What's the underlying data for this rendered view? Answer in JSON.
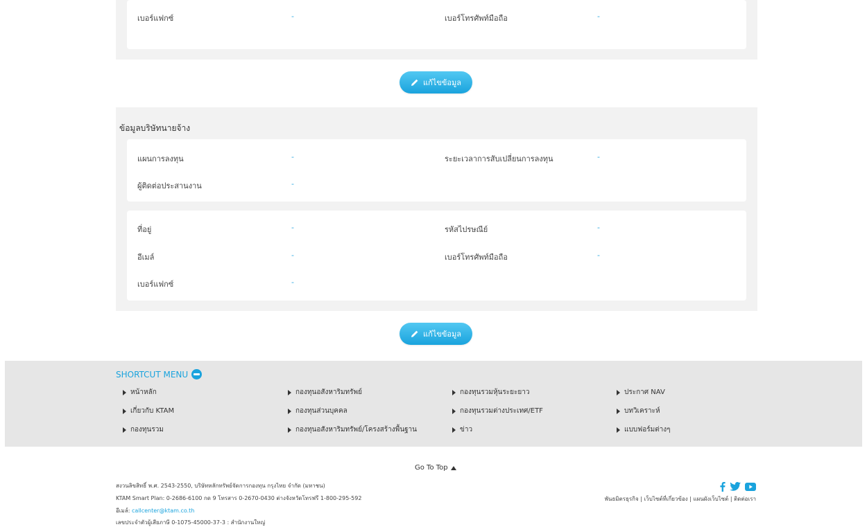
{
  "panel1": {
    "fields": [
      {
        "label": "เบอร์แฟกซ์",
        "value": "-"
      },
      {
        "label": "เบอร์โทรศัพท์มือถือ",
        "value": "-"
      }
    ]
  },
  "edit_button": {
    "label": "แก้ไขข้อมูล"
  },
  "employer": {
    "title": "ข้อมูลบริษัทนายจ้าง",
    "card1": [
      {
        "label": "แผนการลงทุน",
        "value": "-"
      },
      {
        "label": "ระยะเวลาการสับเปลี่ยนการลงทุน",
        "value": "-"
      },
      {
        "label": "ผู้ติดต่อประสานงาน",
        "value": "-"
      }
    ],
    "card2": [
      {
        "label": "ที่อยู่",
        "value": "-"
      },
      {
        "label": "รหัสไปรษณีย์",
        "value": "-"
      },
      {
        "label": "อีเมล์",
        "value": "-"
      },
      {
        "label": "เบอร์โทรศัพท์มือถือ",
        "value": "-"
      },
      {
        "label": "เบอร์แฟกซ์",
        "value": "-"
      }
    ]
  },
  "shortcut": {
    "title": "SHORTCUT MENU",
    "items": [
      "หน้าหลัก",
      "กองทุนอสังหาริมทรัพย์",
      "กองทุนรวมหุ้นระยะยาว",
      "ประกาศ NAV",
      "เกี่ยวกับ KTAM",
      "กองทุนส่วนบุคคล",
      "กองทุนรวมต่างประเทศ/ETF",
      "บทวิเคราะห์",
      "กองทุนรวม",
      "กองทุนอสังหาริมทรัพย์/โครงสร้างพื้นฐาน",
      "ข่าว",
      "แบบฟอร์มต่างๆ"
    ]
  },
  "footer": {
    "goto_top": "Go To Top",
    "copyright": "สงวนลิขสิทธิ์ พ.ศ. 2543-2550, บริษัทหลักทรัพย์จัดการกองทุน กรุงไทย จำกัด (มหาชน)",
    "contact": "KTAM Smart Plan: 0-2686-6100 กด 9 โทรสาร 0-2670-0430 ต่างจังหวัดโทรฟรี 1-800-295-592",
    "email_label": "อีเมล์:",
    "email": "callcenter@ktam.co.th",
    "tax_id": "เลขประจำตัวผู้เสียภาษี 0-1075-45000-37-3 : สำนักงานใหญ่",
    "links": "พันธมิตรธุรกิจ | เว็บไซต์ที่เกี่ยวข้อง | แผนผังเว็บไซต์ | ติดต่อเรา",
    "social": [
      "facebook-icon",
      "twitter-icon",
      "youtube-icon"
    ]
  }
}
